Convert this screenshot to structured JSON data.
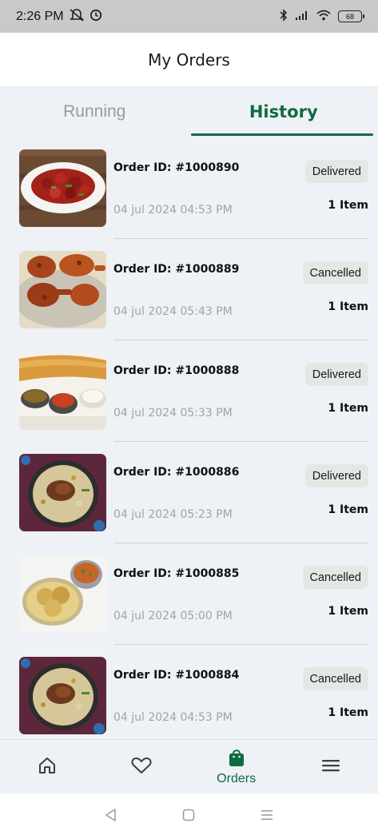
{
  "status_bar": {
    "time": "2:26 PM",
    "battery": "68"
  },
  "header": {
    "title": "My Orders"
  },
  "tabs": [
    {
      "label": "Running",
      "active": false
    },
    {
      "label": "History",
      "active": true
    }
  ],
  "orders": [
    {
      "order_id": "Order ID: #1000890",
      "date": "04 jul 2024 04:53 PM",
      "status": "Delivered",
      "items": "1 Item",
      "image": "chilli-chicken"
    },
    {
      "order_id": "Order ID: #1000889",
      "date": "04 jul 2024 05:43 PM",
      "status": "Cancelled",
      "items": "1 Item",
      "image": "fried-chicken"
    },
    {
      "order_id": "Order ID: #1000888",
      "date": "04 jul 2024 05:33 PM",
      "status": "Delivered",
      "items": "1 Item",
      "image": "masala-dosa"
    },
    {
      "order_id": "Order ID: #1000886",
      "date": "04 jul 2024 05:23 PM",
      "status": "Delivered",
      "items": "1 Item",
      "image": "chicken-biryani"
    },
    {
      "order_id": "Order ID: #1000885",
      "date": "04 jul 2024 05:00 PM",
      "status": "Cancelled",
      "items": "1 Item",
      "image": "puri-bhaji"
    },
    {
      "order_id": "Order ID: #1000884",
      "date": "04 jul 2024 04:53 PM",
      "status": "Cancelled",
      "items": "1 Item",
      "image": "chicken-biryani"
    }
  ],
  "bottom_nav": {
    "items": [
      {
        "icon": "home-icon",
        "label": ""
      },
      {
        "icon": "heart-icon",
        "label": ""
      },
      {
        "icon": "shopping-bag-icon",
        "label": "Orders"
      },
      {
        "icon": "menu-icon",
        "label": ""
      }
    ]
  },
  "colors": {
    "accent": "#0e6b40",
    "status_badge_bg": "#e2e9e4",
    "page_bg": "#eef1f5",
    "muted_text": "#a3a3a3"
  }
}
